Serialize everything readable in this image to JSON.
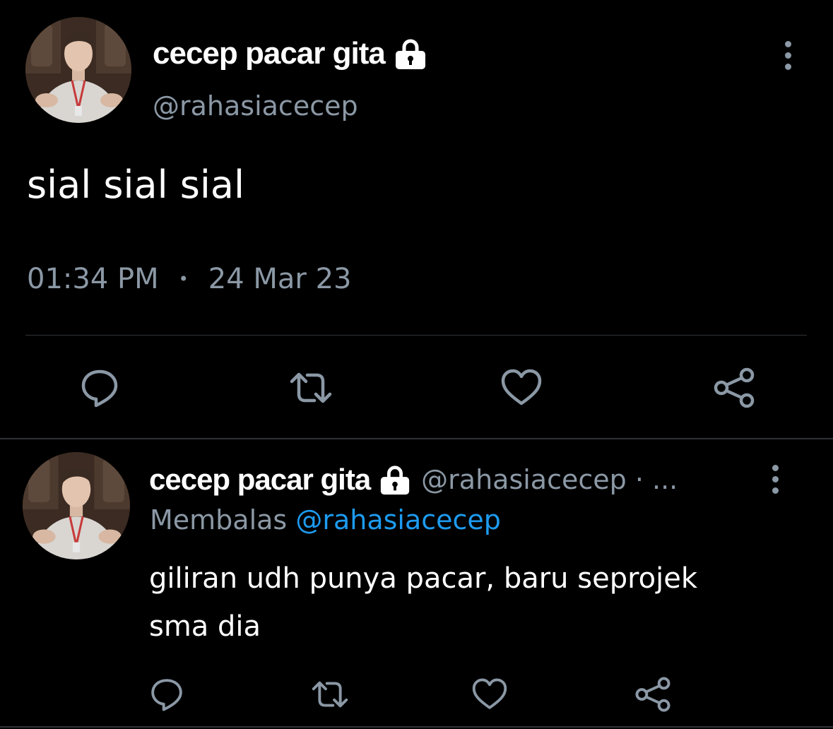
{
  "main_tweet": {
    "display_name": "cecep pacar gita",
    "handle": "@rahasiacecep",
    "text": "sial sial sial",
    "time": "01:34 PM",
    "separator": "•",
    "date": "24 Mar 23",
    "icons": [
      "lock-icon",
      "more-vertical-icon",
      "reply-icon",
      "retweet-icon",
      "like-icon",
      "share-icon"
    ]
  },
  "reply_tweet": {
    "display_name": "cecep pacar gita",
    "handle_meta": "@rahasiacecep · ...",
    "replying_prefix": "Membalas",
    "replying_to": "@rahasiacecep",
    "text_line1": "giliran udh punya pacar, baru seprojek",
    "text_line2": "sma dia",
    "icons": [
      "lock-icon",
      "more-vertical-icon",
      "reply-icon",
      "retweet-icon",
      "like-icon",
      "share-icon"
    ]
  },
  "colors": {
    "background": "#000000",
    "text": "#ffffff",
    "secondary": "#8b98a5",
    "accent": "#1d9bf0",
    "divider": "#2f3336"
  }
}
